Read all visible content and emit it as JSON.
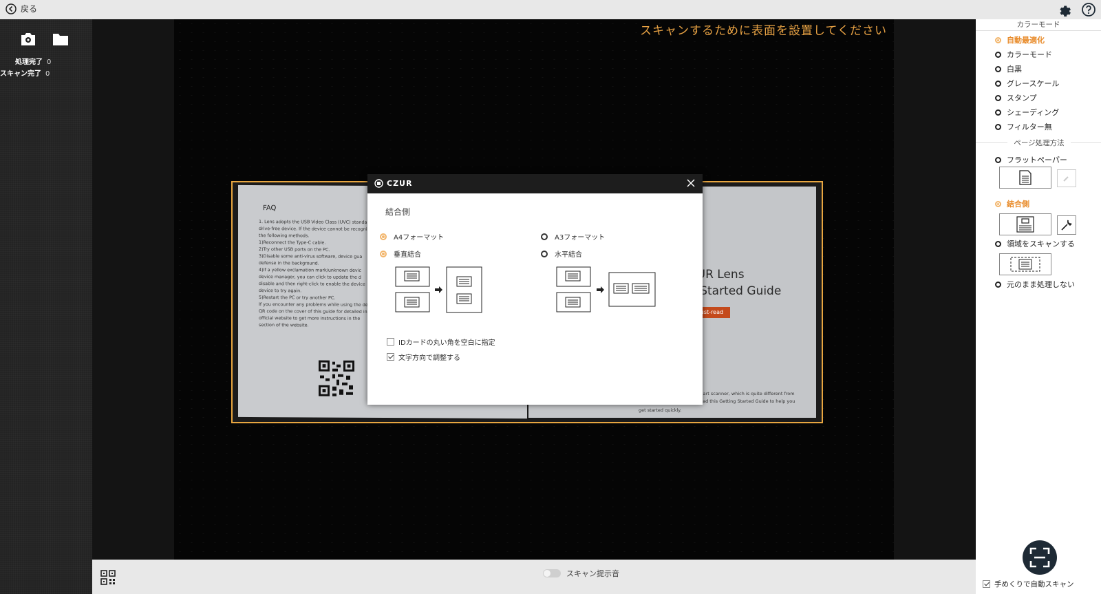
{
  "topbar": {
    "back_label": "戻る"
  },
  "left_panel": {
    "stats": [
      {
        "label": "処理完了",
        "count": "0"
      },
      {
        "label": "スキャン完了",
        "count": "0"
      }
    ]
  },
  "camera": {
    "hint": "スキャンするために表面を設置してください"
  },
  "document": {
    "faq_title": "FAQ",
    "faq_lines": [
      "1. Lens adopts the USB Video Class (UVC) standard p",
      "   drive-free device. If the device cannot be recogniz",
      "   the following methods.",
      " ",
      "   1)Reconnect the Type-C cable.",
      "   2)Try other USB ports on the PC.",
      "   3)Disable some anti-virus software, device gua",
      "   defense in the background.",
      "   4)If a yellow exclamation mark/unknown devic",
      "   device manager, you can click to update the d",
      "   disable and then right-click to enable the device",
      "   device to try again.",
      "   5)Restart the PC or try another PC.",
      " ",
      "If you encounter any problems while using the dev",
      "QR code on the cover of this guide for detailed ins",
      "official website to get more instructions in the",
      "section of the website."
    ],
    "lens_title_1": "ZUR Lens",
    "lens_title_2": "g Started Guide",
    "must_read": "Must-read",
    "lens_foot_1": "v smart scanner, which is quite different from",
    "lens_foot_2": "to read this Getting Started Guide to help you",
    "lens_foot_3": "get started quickly."
  },
  "dialog": {
    "brand": "CZUR",
    "title": "結合側",
    "options": {
      "a4": "A4フォーマット",
      "a3": "A3フォーマット",
      "vertical": "垂直結合",
      "horizontal": "水平結合"
    },
    "check_id_corner": "IDカードの丸い角を空白に指定",
    "check_text_direction": "文字方向で調整する"
  },
  "bottombar": {
    "sound_label": "スキャン提示音"
  },
  "right_panel": {
    "color_mode_header": "カラーモード",
    "color_modes": [
      {
        "label": "自動最適化",
        "selected": true
      },
      {
        "label": "カラーモード",
        "selected": false
      },
      {
        "label": "白黒",
        "selected": false
      },
      {
        "label": "グレースケール",
        "selected": false
      },
      {
        "label": "スタンプ",
        "selected": false
      },
      {
        "label": "シェーディング",
        "selected": false
      },
      {
        "label": "フィルター無",
        "selected": false
      }
    ],
    "page_header": "ページ処理方法",
    "page_modes": [
      {
        "label": "フラットペーパー",
        "selected": false
      },
      {
        "label": "結合側",
        "selected": true
      },
      {
        "label": "領域をスキャンする",
        "selected": false
      },
      {
        "label": "元のまま処理しない",
        "selected": false
      }
    ],
    "auto_scan_label": "手めくりで自動スキャン"
  },
  "colors": {
    "accent": "#e8a640",
    "hint": "#e8a244",
    "selected": "#e88b2a",
    "fab": "#1e2a35"
  }
}
